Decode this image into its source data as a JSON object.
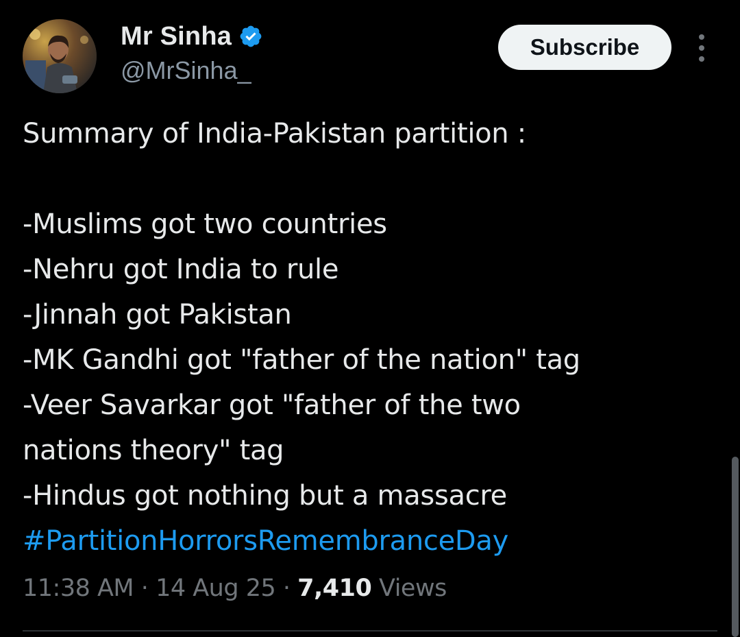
{
  "author": {
    "display_name": "Mr Sinha",
    "handle": "@MrSinha_",
    "verified": true,
    "avatar_icon": "profile-photo"
  },
  "actions": {
    "subscribe_label": "Subscribe",
    "more_icon": "vertical-ellipsis-icon"
  },
  "tweet": {
    "lines": [
      "Summary of India-Pakistan partition :",
      "",
      "-Muslims got two countries",
      "-Nehru got India to rule",
      "-Jinnah got Pakistan",
      "-MK Gandhi got \"father of the nation\" tag",
      "-Veer Savarkar got \"father of the two",
      "nations theory\" tag",
      "-Hindus got nothing but a massacre"
    ],
    "hashtag": "#PartitionHorrorsRemembranceDay"
  },
  "meta": {
    "time": "11:38 AM",
    "date": "14 Aug 25",
    "separator": "·",
    "views_count": "7,410",
    "views_label": "Views"
  },
  "colors": {
    "background": "#000000",
    "text": "#e7e9ea",
    "secondary": "#71767b",
    "link": "#1d9bf0",
    "verified_badge": "#1d9bf0",
    "button_bg": "#eff3f4"
  }
}
